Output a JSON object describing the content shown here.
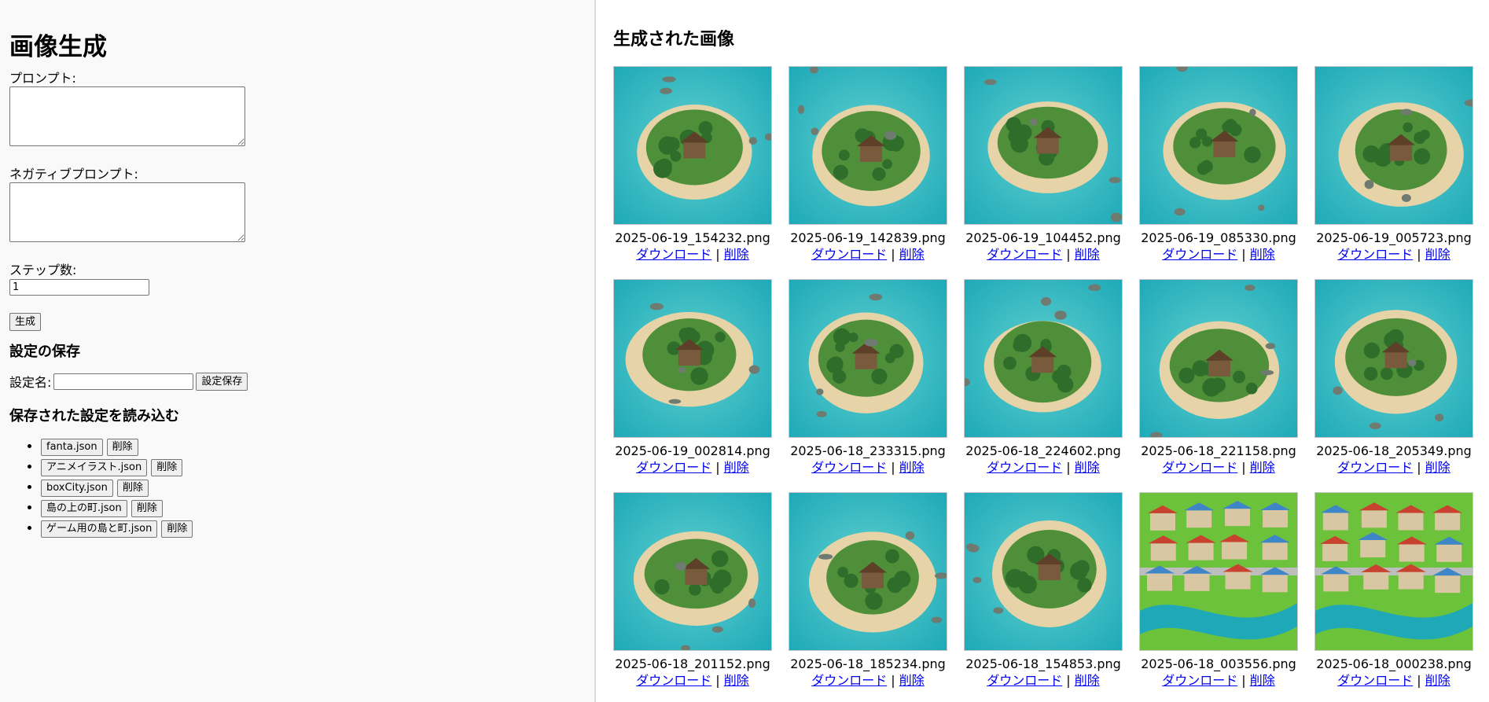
{
  "form": {
    "title": "画像生成",
    "prompt_label": "プロンプト:",
    "prompt_value": "",
    "negative_label": "ネガティブプロンプト:",
    "negative_value": "",
    "steps_label": "ステップ数:",
    "steps_value": "1",
    "generate_label": "生成"
  },
  "save": {
    "heading": "設定の保存",
    "name_label": "設定名:",
    "name_value": "",
    "button_label": "設定保存"
  },
  "load": {
    "heading": "保存された設定を読み込む",
    "delete_label": "削除",
    "configs": [
      "fanta.json",
      "アニメイラスト.json",
      "boxCity.json",
      "島の上の町.json",
      "ゲーム用の島と町.json"
    ]
  },
  "gallery": {
    "heading": "生成された画像",
    "download_label": "ダウンロード",
    "delete_label": "削除",
    "separator": "|",
    "images": [
      {
        "filename": "2025-06-19_154232.png",
        "scene": "island"
      },
      {
        "filename": "2025-06-19_142839.png",
        "scene": "island"
      },
      {
        "filename": "2025-06-19_104452.png",
        "scene": "island"
      },
      {
        "filename": "2025-06-19_085330.png",
        "scene": "island"
      },
      {
        "filename": "2025-06-19_005723.png",
        "scene": "island"
      },
      {
        "filename": "2025-06-19_002814.png",
        "scene": "island"
      },
      {
        "filename": "2025-06-18_233315.png",
        "scene": "island"
      },
      {
        "filename": "2025-06-18_224602.png",
        "scene": "island"
      },
      {
        "filename": "2025-06-18_221158.png",
        "scene": "island"
      },
      {
        "filename": "2025-06-18_205349.png",
        "scene": "island"
      },
      {
        "filename": "2025-06-18_201152.png",
        "scene": "island"
      },
      {
        "filename": "2025-06-18_185234.png",
        "scene": "island"
      },
      {
        "filename": "2025-06-18_154853.png",
        "scene": "island"
      },
      {
        "filename": "2025-06-18_003556.png",
        "scene": "town"
      },
      {
        "filename": "2025-06-18_000238.png",
        "scene": "town"
      }
    ]
  },
  "colors": {
    "ocean": "#1fa9b8",
    "shallow": "#5fd1cf",
    "sand": "#e6d4a8",
    "grass": "#4f8f3a",
    "roof": "#c8422f",
    "link": "#0000ee"
  }
}
